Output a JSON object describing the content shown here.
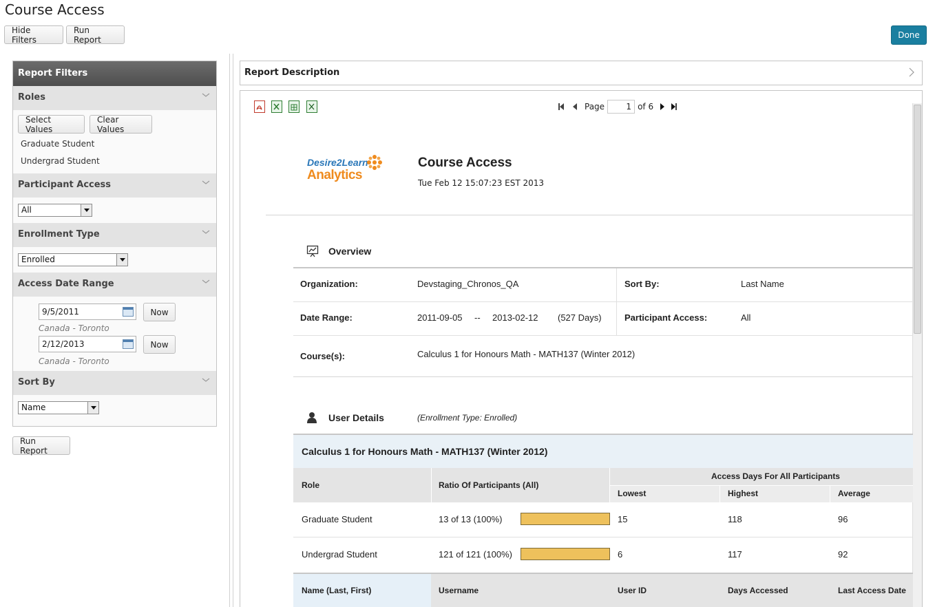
{
  "header": {
    "title": "Course Access",
    "hide_filters": "Hide Filters",
    "run_report": "Run Report",
    "done": "Done"
  },
  "filters": {
    "title": "Report Filters",
    "roles": {
      "label": "Roles",
      "select_values": "Select Values",
      "clear_values": "Clear Values",
      "items": [
        "Graduate Student",
        "Undergrad Student"
      ]
    },
    "participant_access": {
      "label": "Participant Access",
      "value": "All"
    },
    "enrollment_type": {
      "label": "Enrollment Type",
      "value": "Enrolled"
    },
    "access_date_range": {
      "label": "Access Date Range",
      "start": "9/5/2011",
      "end": "2/12/2013",
      "now": "Now",
      "timezone": "Canada - Toronto"
    },
    "sort_by": {
      "label": "Sort By",
      "value": "Name"
    },
    "run_report": "Run Report"
  },
  "report": {
    "description_label": "Report Description",
    "pager": {
      "page_label": "Page",
      "page": "1",
      "of_label": "of 6"
    },
    "logo": {
      "line1": "Desire2Learn",
      "line2": "Analytics"
    },
    "title": "Course Access",
    "generated": "Tue Feb 12 15:07:23 EST 2013",
    "overview": {
      "title": "Overview",
      "organization_label": "Organization:",
      "organization": "Devstaging_Chronos_QA",
      "sort_by_label": "Sort By:",
      "sort_by": "Last Name",
      "date_range_label": "Date Range:",
      "date_start": "2011-09-05",
      "date_sep": "--",
      "date_end": "2013-02-12",
      "days": "(527 Days)",
      "participant_access_label": "Participant Access:",
      "participant_access": "All",
      "courses_label": "Course(s):",
      "courses": "Calculus 1 for Honours Math - MATH137 (Winter 2012)"
    },
    "user_details": {
      "title": "User Details",
      "enrollment_note": "(Enrollment Type: Enrolled)",
      "course": "Calculus 1 for Honours Math - MATH137 (Winter 2012)",
      "headers": {
        "role": "Role",
        "ratio": "Ratio Of Participants (All)",
        "access_days": "Access Days For All Participants",
        "lowest": "Lowest",
        "highest": "Highest",
        "average": "Average"
      },
      "rows": [
        {
          "role": "Graduate Student",
          "ratio": "13 of 13 (100%)",
          "ratio_fraction": 1.0,
          "lowest": "15",
          "highest": "118",
          "average": "96"
        },
        {
          "role": "Undergrad Student",
          "ratio": "121 of 121 (100%)",
          "ratio_fraction": 1.0,
          "lowest": "6",
          "highest": "117",
          "average": "92"
        }
      ],
      "user_headers": [
        "Name (Last, First)",
        "Username",
        "User ID",
        "Days Accessed",
        "Last Access Date"
      ]
    }
  }
}
